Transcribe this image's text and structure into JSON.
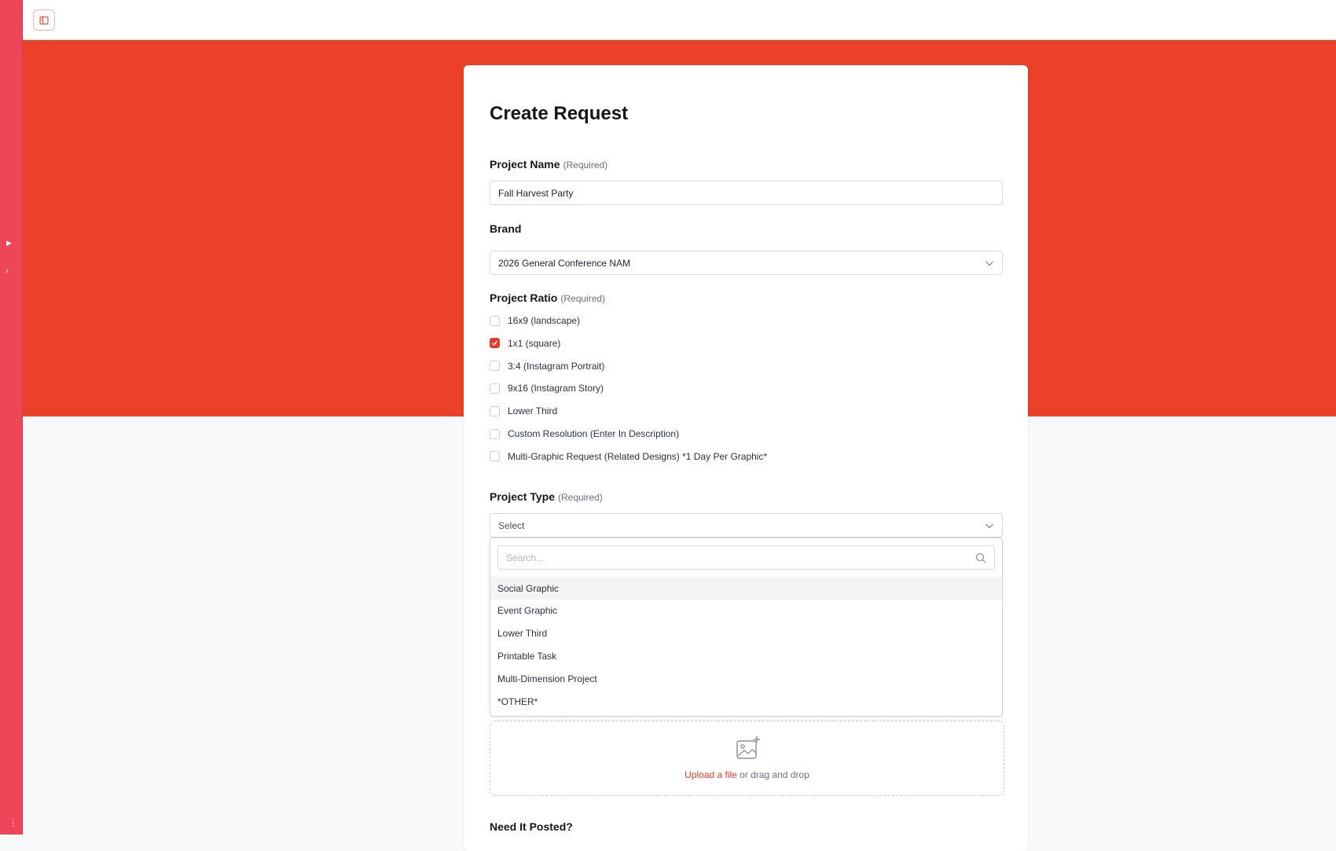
{
  "rail": {
    "play_glyph": "▶",
    "chevron_glyph": "›",
    "dots_glyph": "⋮"
  },
  "form": {
    "title": "Create Request",
    "project_name": {
      "label": "Project Name",
      "required": "(Required)",
      "value": "Fall Harvest Party"
    },
    "brand": {
      "label": "Brand",
      "value": "2026 General Conference NAM"
    },
    "ratio": {
      "label": "Project Ratio",
      "required": "(Required)",
      "options": [
        {
          "label": "16x9 (landscape)",
          "checked": false
        },
        {
          "label": "1x1 (square)",
          "checked": true
        },
        {
          "label": "3:4 (Instagram Portrait)",
          "checked": false
        },
        {
          "label": "9x16 (Instagram Story)",
          "checked": false
        },
        {
          "label": "Lower Third",
          "checked": false
        },
        {
          "label": "Custom Resolution (Enter In Description)",
          "checked": false
        },
        {
          "label": "Multi-Graphic Request (Related Designs) *1 Day Per Graphic*",
          "checked": false
        }
      ]
    },
    "project_type": {
      "label": "Project Type",
      "required": "(Required)",
      "placeholder": "Select",
      "search_placeholder": "Search...",
      "options": [
        "Social Graphic",
        "Event Graphic",
        "Lower Third",
        "Printable Task",
        "Multi-Dimension Project",
        "*OTHER*"
      ]
    },
    "upload": {
      "link": "Upload a file",
      "text": " or drag and drop"
    },
    "posted": {
      "label": "Need It Posted?"
    }
  },
  "colors": {
    "accent": "#e23d28",
    "banner": "#ea4128",
    "rail": "#ec4658"
  }
}
